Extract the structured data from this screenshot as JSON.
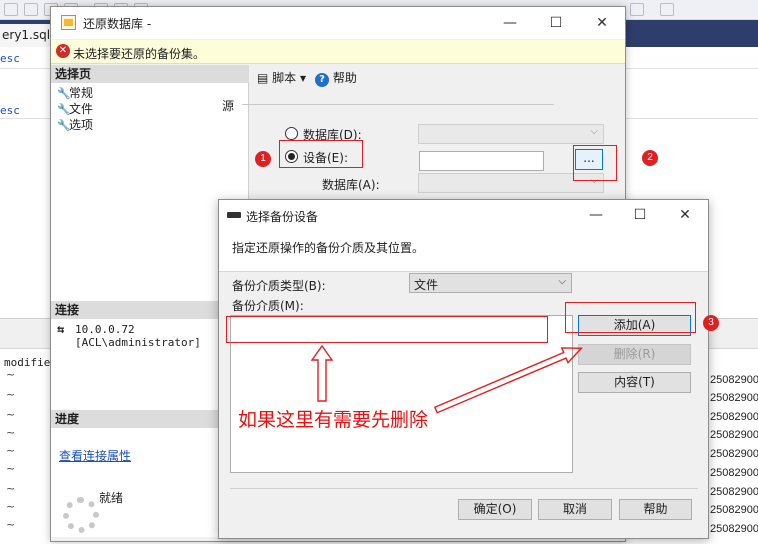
{
  "background": {
    "tab_label": "ery1.sql -",
    "code_lines": [
      "esc",
      "esc"
    ],
    "column_header": "modifier",
    "row_marker": "~",
    "row_values": [
      "25082900",
      "25082900",
      "25082900",
      "25082900",
      "25082900",
      "25082900",
      "25082900",
      "25082900",
      "25082900"
    ]
  },
  "restore_dialog": {
    "title": "还原数据库 -",
    "error_message": "未选择要还原的备份集。",
    "select_page": {
      "header": "选择页",
      "items": [
        "常规",
        "文件",
        "选项"
      ]
    },
    "toolbar": {
      "script_label": "脚本",
      "help_label": "帮助"
    },
    "source": {
      "section_label": "源",
      "database_label": "数据库(D):",
      "device_label": "设备(E):",
      "device_database_label": "数据库(A):",
      "browse_label": "...",
      "selected_option": "device"
    },
    "connection": {
      "header": "连接",
      "server": "10.0.0.72",
      "user": "[ACL\\administrator]",
      "link": "查看连接属性"
    },
    "progress": {
      "header": "进度",
      "status": "就绪"
    },
    "window_controls": {
      "minimize": "—",
      "maximize": "☐",
      "close": "✕"
    }
  },
  "device_dialog": {
    "title": "选择备份设备",
    "description": "指定还原操作的备份介质及其位置。",
    "media_type_label": "备份介质类型(B):",
    "media_type_value": "文件",
    "media_label": "备份介质(M):",
    "media_items": [],
    "buttons": {
      "add": "添加(A)",
      "remove": "删除(R)",
      "contents": "内容(T)",
      "ok": "确定(O)",
      "cancel": "取消",
      "help": "帮助"
    },
    "window_controls": {
      "minimize": "—",
      "maximize": "☐",
      "close": "✕"
    }
  },
  "annotations": {
    "badges": [
      "1",
      "2",
      "3"
    ],
    "note": "如果这里有需要先删除",
    "color": "#e02020"
  }
}
